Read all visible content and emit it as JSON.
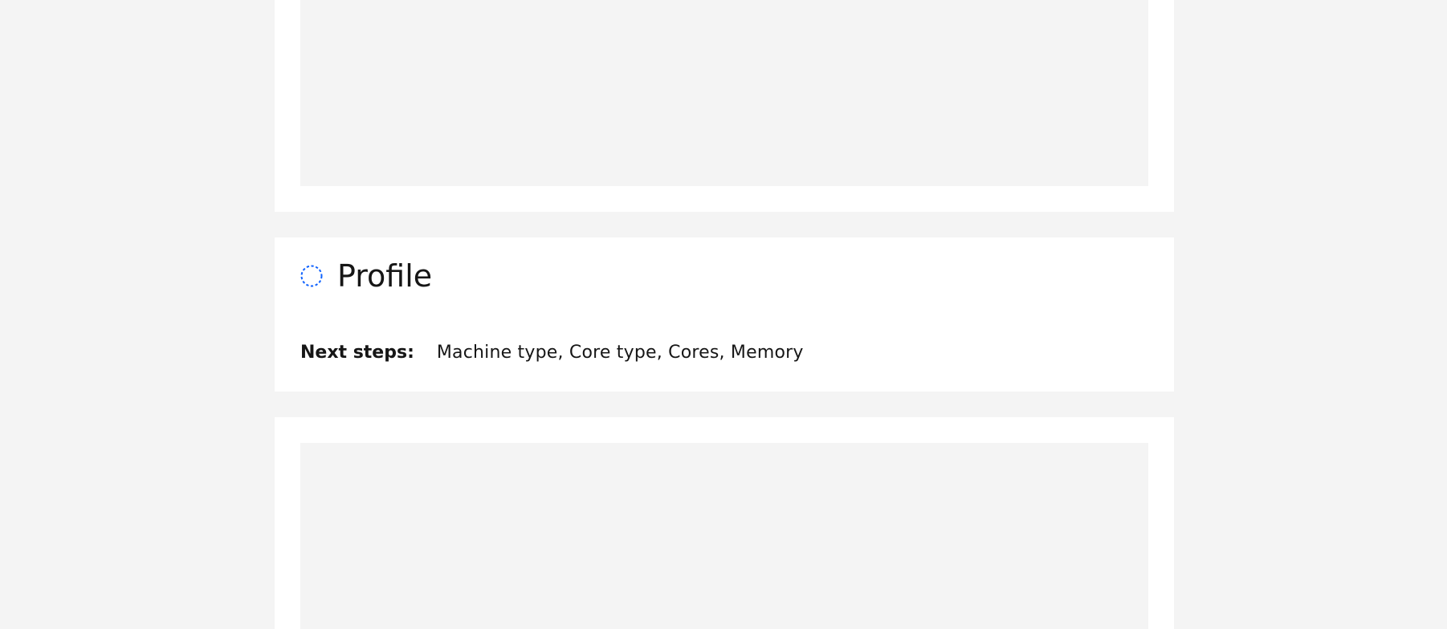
{
  "colors": {
    "page_background": "#f4f4f4",
    "card_background": "#ffffff",
    "placeholder_background": "#f4f4f4",
    "text": "#161616",
    "status_icon": "#0f62fe"
  },
  "profile_section": {
    "title": "Profile",
    "status_icon": "dashed-circle-icon",
    "next_steps_label": "Next steps:",
    "next_steps_value": "Machine type, Core type, Cores, Memory"
  }
}
